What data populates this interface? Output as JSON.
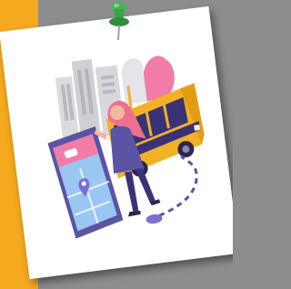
{
  "scene": {
    "background_color": "#8d8d8f",
    "accent_strip_color": "#f5a91e",
    "card_color": "#ffffff",
    "pin_color": "#3aa34a",
    "illustration_subject": "person-boarding-bus-with-phone-map"
  },
  "palette": {
    "bus": "#f2b227",
    "bus_dark": "#3a3276",
    "phone_frame": "#5b53a3",
    "phone_screen": "#9ac7f2",
    "map_pin": "#7b6fd1",
    "hair": "#ef6f8f",
    "pink_shape": "#f07ca7",
    "buildings": "#d8d8dc",
    "skin": "#f2b9a0"
  }
}
